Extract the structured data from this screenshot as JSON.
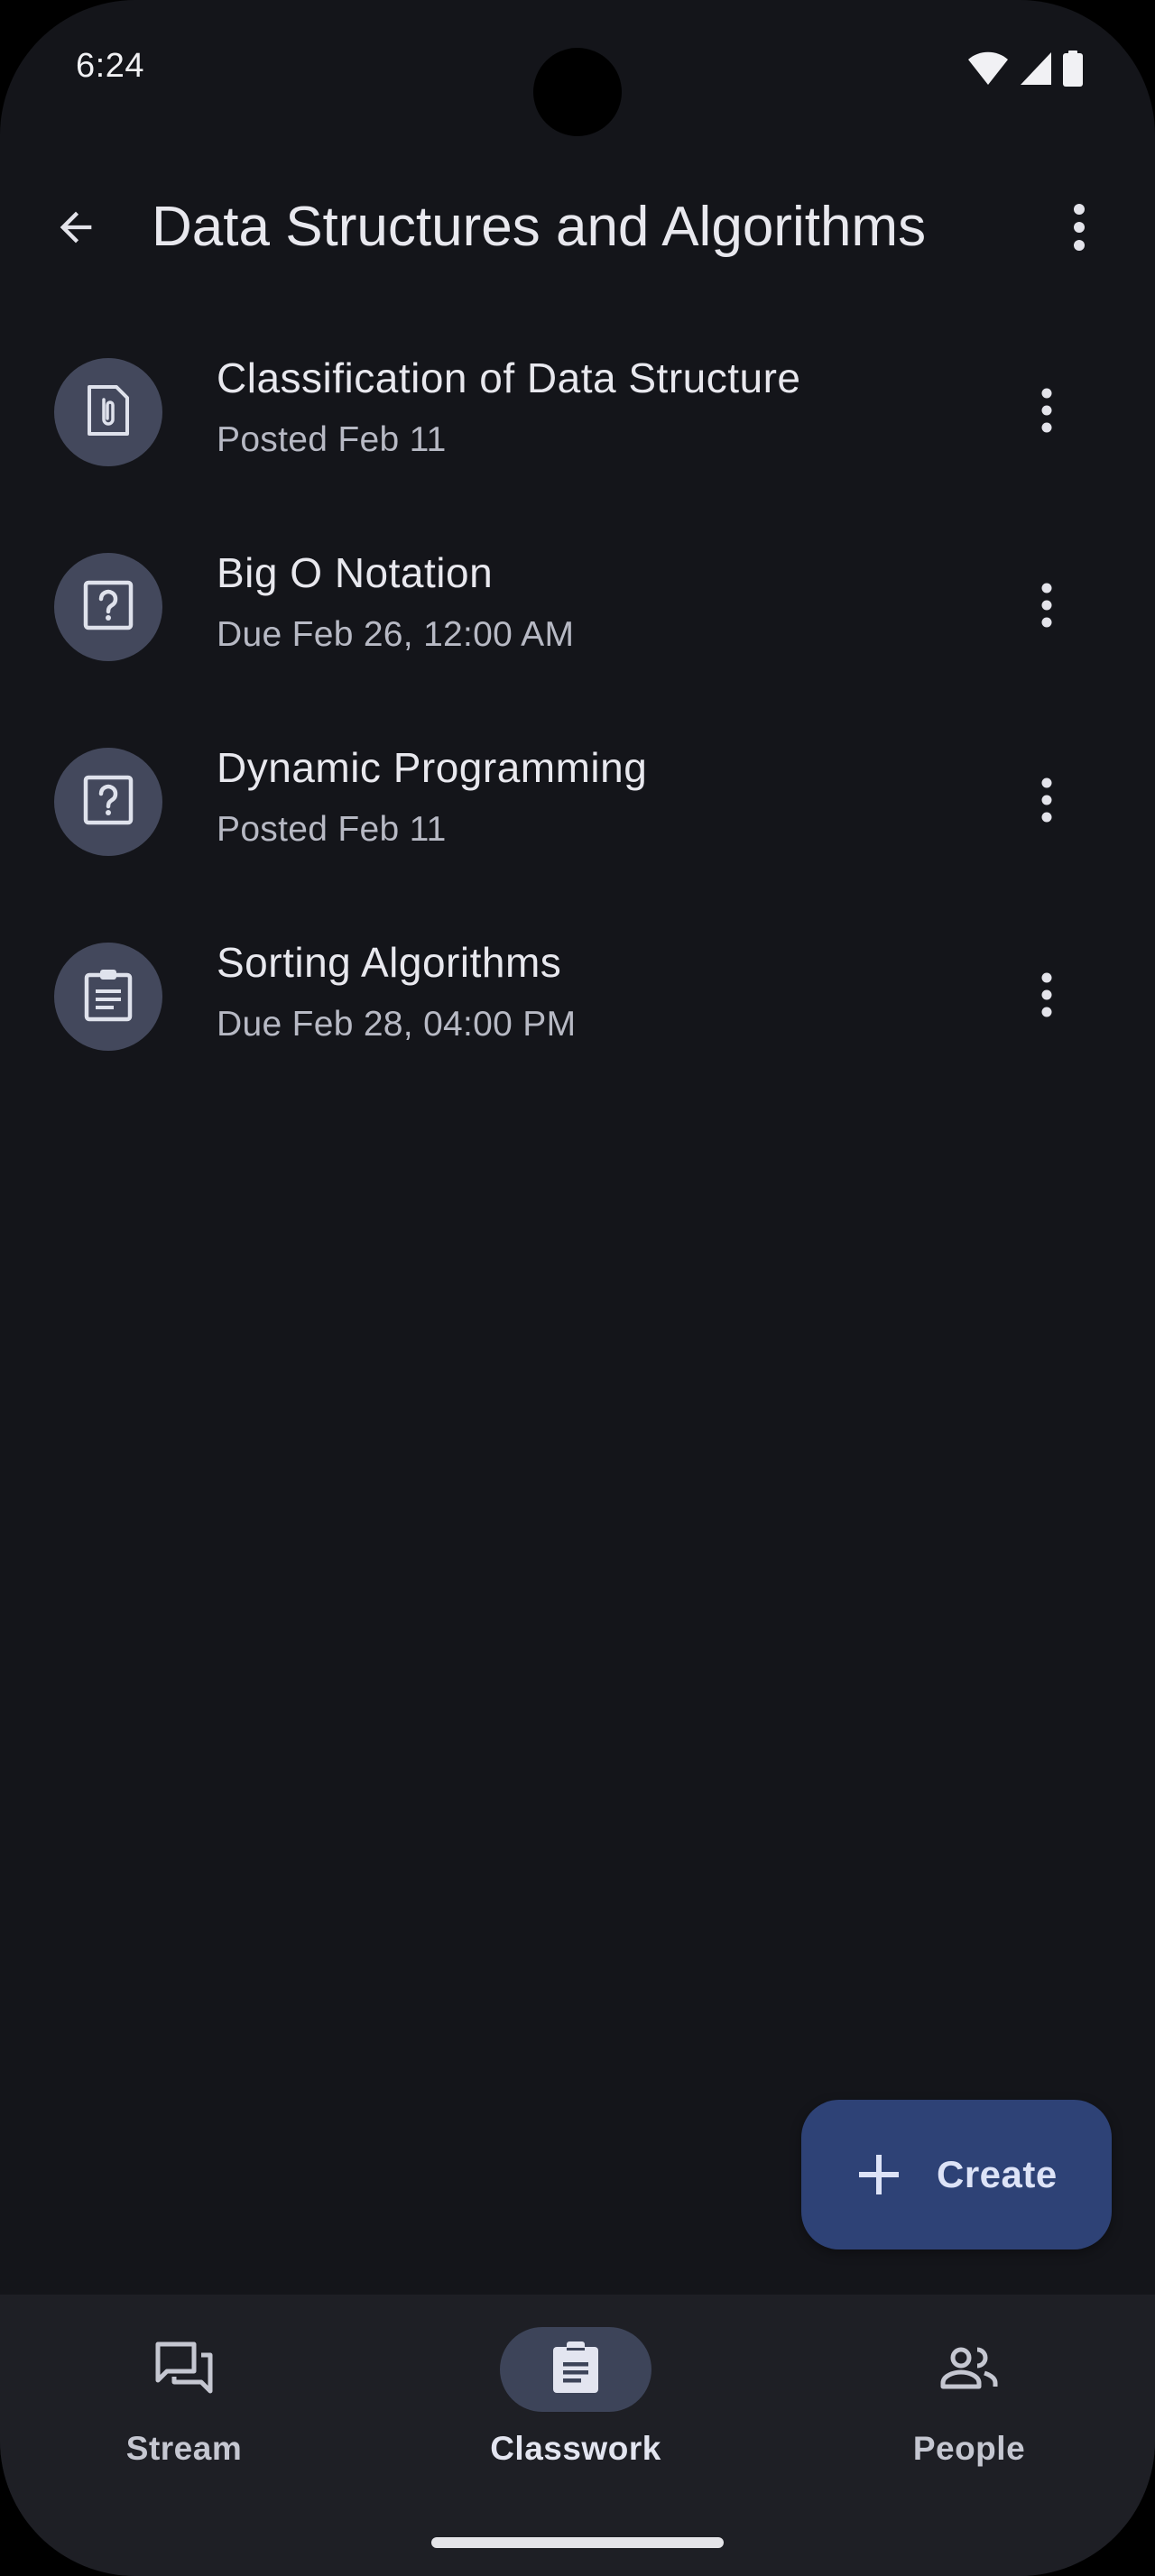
{
  "status_bar": {
    "time": "6:24",
    "icons": [
      "wifi-icon",
      "signal-icon",
      "battery-icon"
    ]
  },
  "app_bar": {
    "back_icon": "arrow-back-icon",
    "title": "Data Structures and Algorithms",
    "overflow_icon": "more-vert-icon"
  },
  "classwork": {
    "items": [
      {
        "icon": "attachment-file-icon",
        "title": "Classification of Data Structure",
        "subtitle": "Posted Feb 11"
      },
      {
        "icon": "question-icon",
        "title": "Big O Notation",
        "subtitle": "Due Feb 26, 12:00 AM"
      },
      {
        "icon": "question-icon",
        "title": "Dynamic Programming",
        "subtitle": "Posted Feb 11"
      },
      {
        "icon": "assignment-icon",
        "title": "Sorting Algorithms",
        "subtitle": "Due Feb 28, 04:00 PM"
      }
    ]
  },
  "fab": {
    "icon": "plus-icon",
    "label": "Create"
  },
  "bottom_nav": {
    "items": [
      {
        "icon": "forum-icon",
        "label": "Stream",
        "active": false
      },
      {
        "icon": "assignment-icon",
        "label": "Classwork",
        "active": true
      },
      {
        "icon": "people-icon",
        "label": "People",
        "active": false
      }
    ]
  },
  "colors": {
    "background": "#14151a",
    "icon_circle": "#43485c",
    "fab": "#2e4276",
    "nav_background": "#1e1f25",
    "nav_active_indicator": "#3d4459"
  }
}
